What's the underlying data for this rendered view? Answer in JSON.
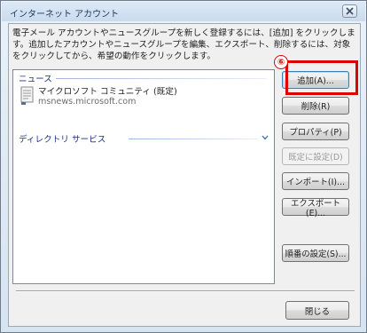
{
  "window": {
    "title": "インターネット アカウント"
  },
  "description": "電子メール アカウントやニュースグループを新しく登録するには、[追加] をクリックします。追加したアカウントやニュースグループを編集、エクスポート、削除するには、対象をクリックしてから、希望の動作をクリックします。",
  "list": {
    "groups": [
      {
        "header": "ニュース"
      },
      {
        "header": "ディレクトリ サービス"
      }
    ],
    "items": [
      {
        "name": "マイクロソフト コミュニティ (既定)",
        "server": "msnews.microsoft.com",
        "icon": "newsgroup-icon"
      }
    ]
  },
  "buttons": {
    "add": "追加(A)...",
    "remove": "削除(R)",
    "properties": "プロパティ(P)",
    "set_default": "既定に設定(D)",
    "import": "インポート(I)...",
    "export": "エクスポート(E)...",
    "order": "順番の設定(S)...",
    "close": "閉じる"
  },
  "annotation": {
    "number": "⑥",
    "color": "#e00000"
  }
}
